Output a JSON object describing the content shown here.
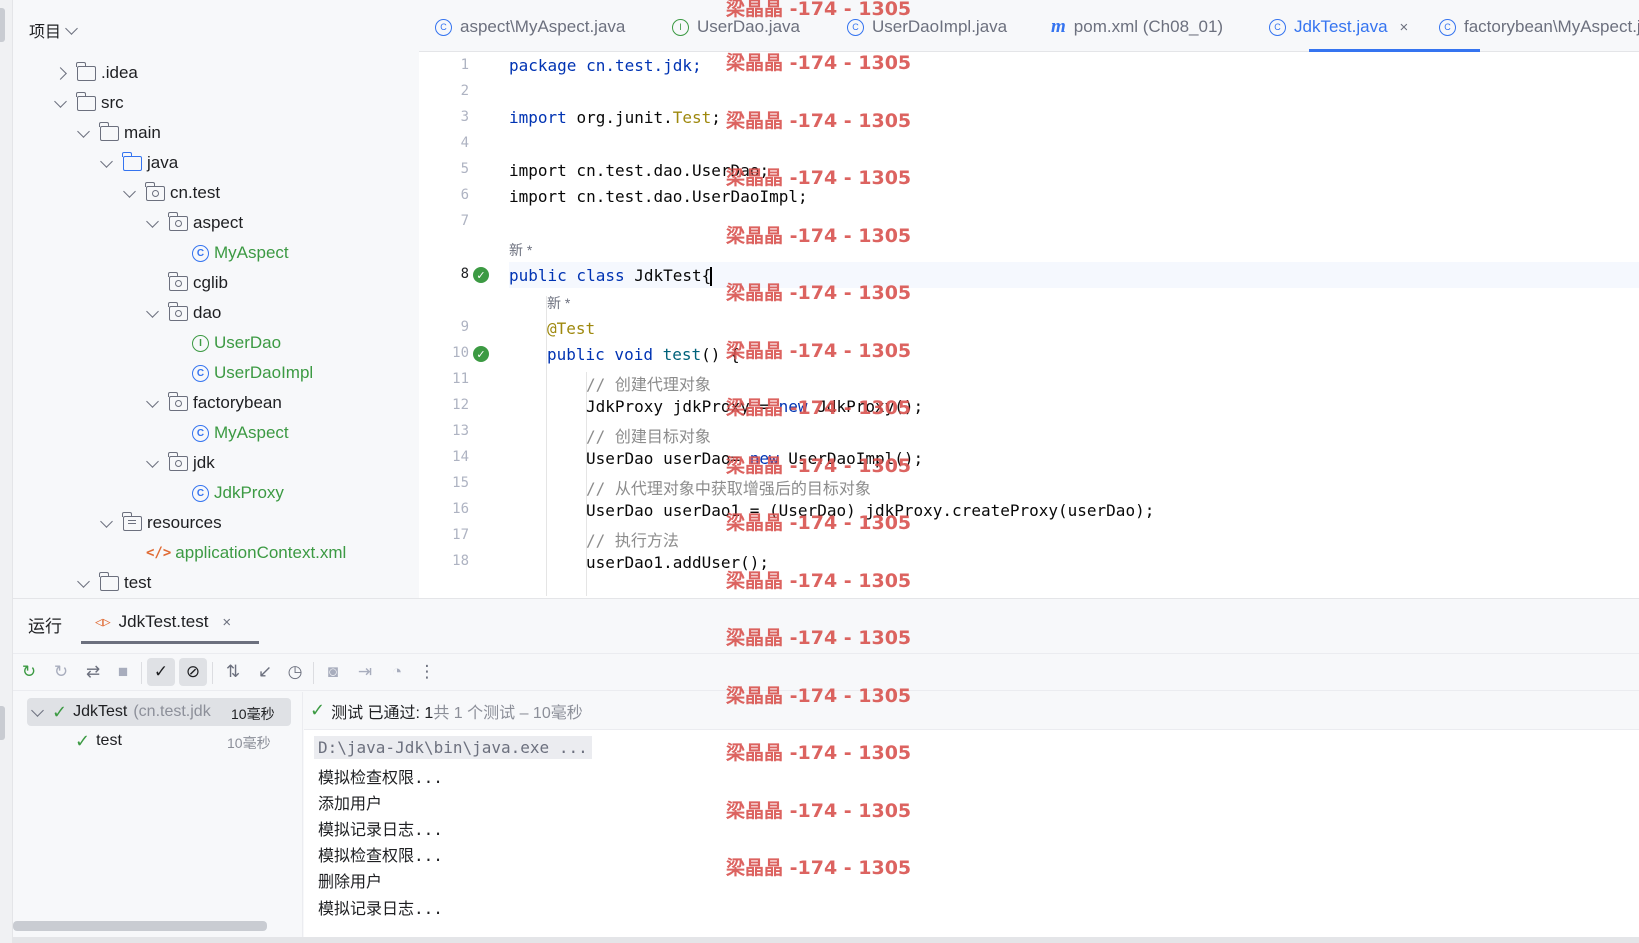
{
  "project": {
    "title": "项目",
    "tree": [
      {
        "label": ".idea",
        "depth": 1,
        "kind": "folder",
        "expanded": false
      },
      {
        "label": "src",
        "depth": 1,
        "kind": "folder",
        "expanded": true
      },
      {
        "label": "main",
        "depth": 2,
        "kind": "folder",
        "expanded": true
      },
      {
        "label": "java",
        "depth": 3,
        "kind": "folder-blue",
        "expanded": true
      },
      {
        "label": "cn.test",
        "depth": 4,
        "kind": "package",
        "expanded": true
      },
      {
        "label": "aspect",
        "depth": 5,
        "kind": "package",
        "expanded": true
      },
      {
        "label": "MyAspect",
        "depth": 6,
        "kind": "class"
      },
      {
        "label": "cglib",
        "depth": 5,
        "kind": "package",
        "expanded": null
      },
      {
        "label": "dao",
        "depth": 5,
        "kind": "package",
        "expanded": true
      },
      {
        "label": "UserDao",
        "depth": 6,
        "kind": "interface"
      },
      {
        "label": "UserDaoImpl",
        "depth": 6,
        "kind": "class"
      },
      {
        "label": "factorybean",
        "depth": 5,
        "kind": "package",
        "expanded": true
      },
      {
        "label": "MyAspect",
        "depth": 6,
        "kind": "class"
      },
      {
        "label": "jdk",
        "depth": 5,
        "kind": "package",
        "expanded": true
      },
      {
        "label": "JdkProxy",
        "depth": 6,
        "kind": "class"
      },
      {
        "label": "resources",
        "depth": 3,
        "kind": "resources",
        "expanded": true
      },
      {
        "label": "applicationContext.xml",
        "depth": 4,
        "kind": "xml"
      },
      {
        "label": "test",
        "depth": 2,
        "kind": "folder",
        "expanded": true
      }
    ]
  },
  "tabs": [
    {
      "label": "aspect\\MyAspect.java",
      "icon": "class-icon"
    },
    {
      "label": "UserDao.java",
      "icon": "interface-icon"
    },
    {
      "label": "UserDaoImpl.java",
      "icon": "class-icon"
    },
    {
      "label": "pom.xml (Ch08_01)",
      "icon": "maven-icon"
    },
    {
      "label": "JdkTest.java",
      "icon": "class-icon",
      "active": true,
      "close": "×"
    },
    {
      "label": "factorybean\\MyAspect.java",
      "icon": "class-icon"
    }
  ],
  "editor": {
    "line_numbers": [
      "1",
      "2",
      "3",
      "4",
      "5",
      "6",
      "7",
      "8",
      "9",
      "10",
      "11",
      "12",
      "13",
      "14",
      "15",
      "16",
      "17",
      "18"
    ],
    "hint_new": "新 *",
    "lines": {
      "l1": "package cn.test.jdk;",
      "l3a": "import ",
      "l3b": "org.junit.",
      "l3c": "Test",
      "l3d": ";",
      "l5": "import cn.test.dao.UserDao;",
      "l6": "import cn.test.dao.UserDaoImpl;",
      "l8a": "public class ",
      "l8b": "JdkTest{",
      "l9": "@Test",
      "l10a": "public void ",
      "l10b": "test",
      "l10c": "() {",
      "l11": "// 创建代理对象",
      "l12a": "JdkProxy jdkProxy = ",
      "l12b": "new",
      "l12c": " JdkProxy();",
      "l13": "// 创建目标对象",
      "l14a": "UserDao userDao= ",
      "l14b": "new",
      "l14c": " UserDaoImpl();",
      "l15": "// 从代理对象中获取增强后的目标对象",
      "l16": "UserDao userDao1 = (UserDao) jdkProxy.createProxy(userDao);",
      "l17": "// 执行方法",
      "l18": "userDao1.addUser();"
    }
  },
  "run": {
    "title": "运行",
    "tab_label": "JdkTest.test",
    "tab_close": "×",
    "tree_root_label": "JdkTest",
    "tree_root_pkg": "(cn.test.jdk",
    "tree_root_time": "10毫秒",
    "tree_child_label": "test",
    "tree_child_time": "10毫秒",
    "status_prefix": "测试 已通过: 1",
    "status_count": "共 1 个测试 – 10毫秒",
    "console": [
      "D:\\java-Jdk\\bin\\java.exe ...",
      "模拟检查权限...",
      "添加用户",
      "模拟记录日志...",
      "模拟检查权限...",
      "删除用户",
      "模拟记录日志..."
    ]
  },
  "watermark": "梁晶晶 -174 - 1305",
  "colors": {
    "accent": "#3574f0",
    "success": "#3c9a43",
    "watermark": "#d9534f"
  }
}
